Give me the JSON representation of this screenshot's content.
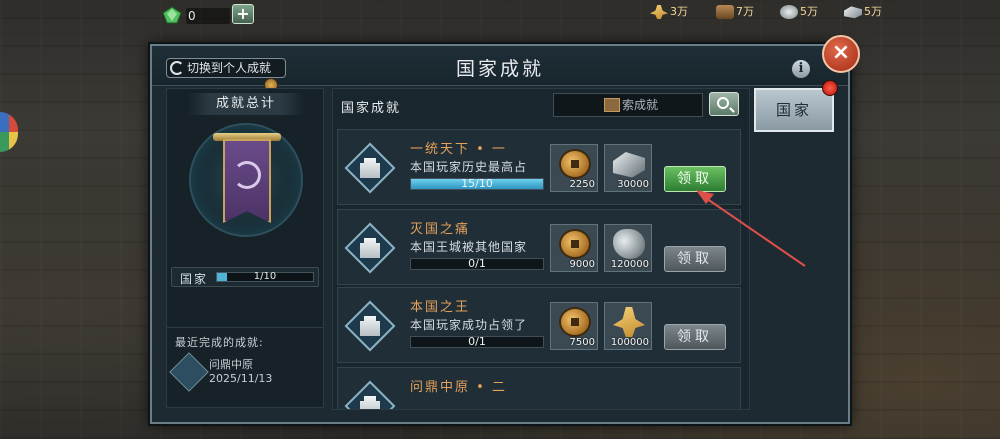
{
  "topbar": {
    "gem_value": "0",
    "add_label": "+",
    "resources": [
      {
        "icon": "grain-icon",
        "value": "3万"
      },
      {
        "icon": "wood-icon",
        "value": "7万"
      },
      {
        "icon": "stone-icon",
        "value": "5万"
      },
      {
        "icon": "iron-icon",
        "value": "5万"
      }
    ]
  },
  "panel": {
    "title": "国家成就",
    "switch_label": "切换到个人成就",
    "info_label": "i",
    "close_label": "×"
  },
  "summary": {
    "title": "成就总计",
    "progress_label": "国家",
    "progress_text": "1/10",
    "progress_fraction": 0.1,
    "recent_title": "最近完成的成就:",
    "recent_name": "问鼎中原",
    "recent_date": "2025/11/13"
  },
  "list": {
    "title": "国家成就",
    "search_placeholder": "索成就",
    "items": [
      {
        "name": "一统天下 • 一",
        "desc": "本国玩家历史最高占",
        "progress": "15/10",
        "fraction": 1.0,
        "rewards": [
          {
            "icon": "copper-coin-icon",
            "value": "2250"
          },
          {
            "icon": "iron-icon",
            "value": "30000"
          }
        ],
        "claim": "领取",
        "claim_state": "active"
      },
      {
        "name": "灭国之痛",
        "desc": "本国王城被其他国家",
        "progress": "0/1",
        "fraction": 0,
        "rewards": [
          {
            "icon": "copper-coin-icon",
            "value": "9000"
          },
          {
            "icon": "stone-icon",
            "value": "120000"
          }
        ],
        "claim": "领取",
        "claim_state": "disabled"
      },
      {
        "name": "本国之王",
        "desc": "本国玩家成功占领了",
        "progress": "0/1",
        "fraction": 0,
        "rewards": [
          {
            "icon": "copper-coin-icon",
            "value": "7500"
          },
          {
            "icon": "grain-icon",
            "value": "100000"
          }
        ],
        "claim": "领取",
        "claim_state": "disabled"
      },
      {
        "name": "问鼎中原 • 二",
        "desc": "",
        "progress": "",
        "fraction": 0,
        "rewards": [],
        "claim": "",
        "claim_state": "hidden"
      }
    ]
  },
  "side_tab": {
    "label": "国家"
  },
  "colors": {
    "accent_green": "#2d7d33",
    "progress_blue": "#4fb3d6",
    "title_orange": "#e5a05a",
    "annotation_red": "#e0504a"
  }
}
